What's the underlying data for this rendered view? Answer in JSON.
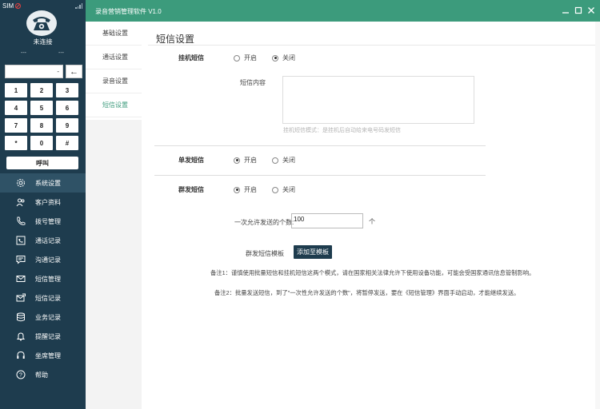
{
  "app": {
    "title": "录音营销管理软件 V1.0"
  },
  "phone": {
    "sim_label": "SIM",
    "status": "未连接",
    "left_value": "---",
    "right_value": "---",
    "dial_value": "-",
    "backspace": "←",
    "keys": [
      "1",
      "2",
      "3",
      "4",
      "5",
      "6",
      "7",
      "8",
      "9",
      "*",
      "0",
      "#"
    ],
    "call_label": "呼叫"
  },
  "nav": {
    "items": [
      {
        "label": "系统设置",
        "icon": "gear-icon"
      },
      {
        "label": "客户资料",
        "icon": "users-icon"
      },
      {
        "label": "拨号管理",
        "icon": "phone-icon"
      },
      {
        "label": "通话记录",
        "icon": "call-log-icon"
      },
      {
        "label": "沟通记录",
        "icon": "chat-icon"
      },
      {
        "label": "短信管理",
        "icon": "mail-icon"
      },
      {
        "label": "短信记录",
        "icon": "mail-send-icon"
      },
      {
        "label": "业务记录",
        "icon": "database-icon"
      },
      {
        "label": "提醒记录",
        "icon": "bell-icon"
      },
      {
        "label": "坐席管理",
        "icon": "headset-icon"
      },
      {
        "label": "帮助",
        "icon": "help-icon"
      }
    ],
    "active_index": 0
  },
  "submenu": {
    "items": [
      "基础设置",
      "通话设置",
      "录音设置",
      "短信设置"
    ],
    "active_index": 3
  },
  "sms_settings": {
    "title": "短信设置",
    "hangup_label": "挂机短信",
    "open_label": "开启",
    "close_label": "关闭",
    "hangup_value": "关闭",
    "content_label": "短信内容",
    "content_value": "",
    "content_hint": "挂机短信模式：是挂机后自动给来电号码发短信",
    "single_label": "单发短信",
    "single_value": "开启",
    "group_label": "群发短信",
    "group_value": "开启",
    "count_label": "一次允许发送的个数:",
    "count_value": "100",
    "count_unit": "个",
    "template_label": "群发短信模板",
    "template_button": "添加至模板",
    "note1": "备注1：谨慎使用批量短信和挂机短信这两个模式，请在国家相关法律允许下使用设备功能，可能会受国家通讯信息管制影响。",
    "note2": "备注2：批量发送短信，到了\"一次性允许发送的个数\"，将暂停发送，要在《短信管理》界面手动启动，才能继续发送。"
  },
  "colors": {
    "sidebar": "#1e3c4e",
    "titlebar": "#3c9b7c",
    "accent": "#3c9b7c"
  }
}
